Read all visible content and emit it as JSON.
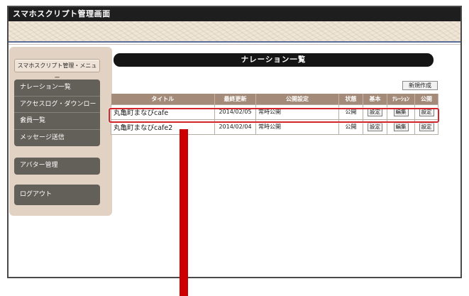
{
  "app": {
    "title": "スマホスクリプト管理画面"
  },
  "sidebar": {
    "menu_title": "スマホスクリプト管理・メニュー",
    "group1": [
      {
        "label": "ナレーション一覧"
      },
      {
        "label": "アクセスログ・ダウンロード"
      },
      {
        "label": "会員一覧"
      },
      {
        "label": "メッセージ送信"
      }
    ],
    "group2": [
      {
        "label": "アバター管理"
      }
    ],
    "group3": [
      {
        "label": "ログアウト"
      }
    ]
  },
  "main": {
    "heading": "ナレーション一覧",
    "new_button": "新規作成",
    "table": {
      "columns": [
        "タイトル",
        "最終更新",
        "公開設定",
        "状態",
        "基本",
        "ﾅﾚｰｼｮﾝ",
        "公開"
      ],
      "rows": [
        {
          "title": "丸亀町まなびcafe",
          "updated": "2014/02/05",
          "visibility": "常時公開",
          "status": "公開",
          "basic": "設定",
          "narration": "編集",
          "publish": "設定"
        },
        {
          "title": "丸亀町まなびcafe2",
          "updated": "2014/02/04",
          "visibility": "常時公開",
          "status": "公開",
          "basic": "設定",
          "narration": "編集",
          "publish": "設定"
        }
      ]
    }
  },
  "colors": {
    "header_bar": "#1e1e1e",
    "sidebar_bg": "#e2d2c3",
    "nav_bg": "#635f59",
    "table_header": "#a48a78",
    "highlight": "#d2242b",
    "indicator": "#cc0000"
  }
}
